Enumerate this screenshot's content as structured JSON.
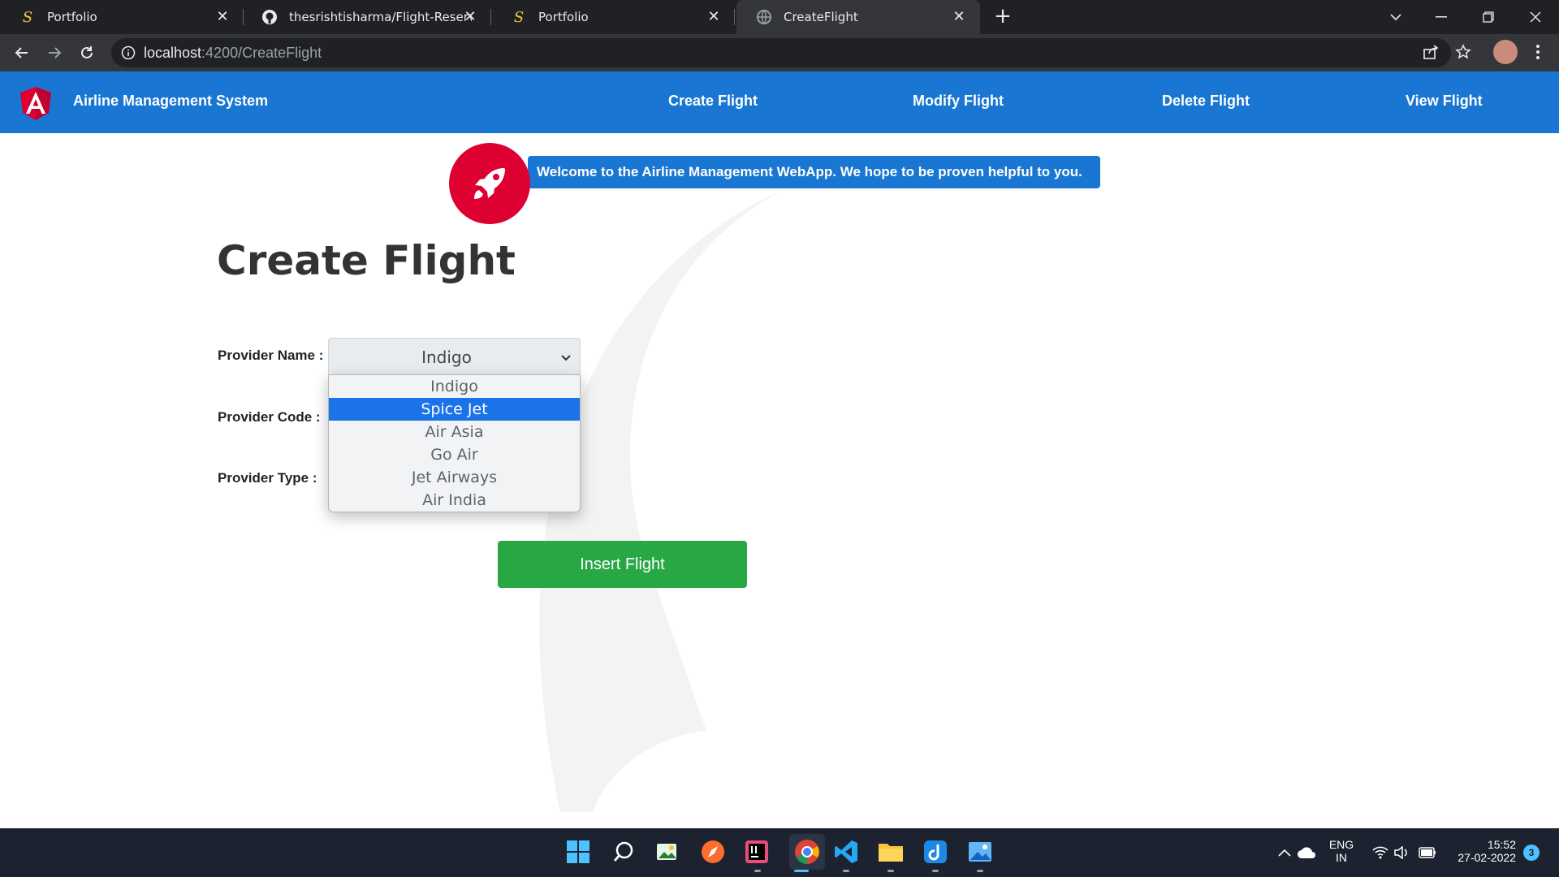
{
  "browser": {
    "tabs": [
      {
        "title": "Portfolio",
        "icon": "portfolio-s-icon",
        "active": false
      },
      {
        "title": "thesrishtisharma/Flight-Reservati",
        "icon": "github-icon",
        "active": false
      },
      {
        "title": "Portfolio",
        "icon": "portfolio-s-icon",
        "active": false
      },
      {
        "title": "CreateFlight",
        "icon": "globe-icon",
        "active": true
      }
    ],
    "url_host": "localhost",
    "url_path": ":4200/CreateFlight"
  },
  "navbar": {
    "brand": "Airline Management System",
    "links": [
      "Create Flight",
      "Modify Flight",
      "Delete Flight",
      "View Flight"
    ]
  },
  "banner": {
    "text": "Welcome to the Airline Management WebApp. We hope to be proven helpful to you."
  },
  "form": {
    "title": "Create Flight",
    "provider_name_label": "Provider Name :",
    "provider_code_label": "Provider Code :",
    "provider_type_label": "Provider Type :",
    "provider_name_value": "Indigo",
    "provider_options": [
      "Indigo",
      "Spice Jet",
      "Air Asia",
      "Go Air",
      "Jet Airways",
      "Air India"
    ],
    "highlighted_option": "Spice Jet",
    "submit_label": "Insert Flight"
  },
  "taskbar": {
    "language": "ENG",
    "region": "IN",
    "time": "15:52",
    "date": "27-02-2022",
    "notification_count": "3"
  },
  "colors": {
    "navbar": "#1976d2",
    "angular_red": "#dd0031",
    "submit_green": "#28a745",
    "option_highlight": "#1a73e8"
  }
}
